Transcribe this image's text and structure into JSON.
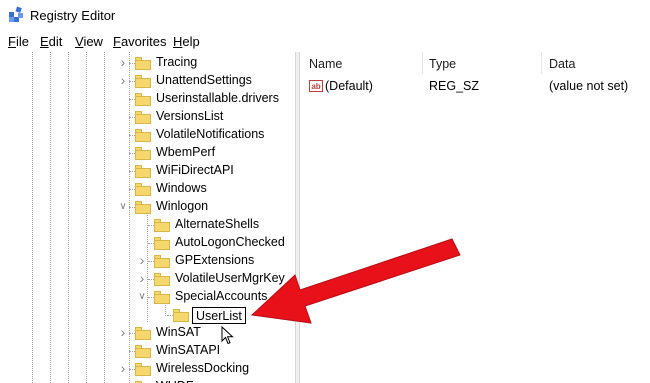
{
  "window": {
    "title": "Registry Editor"
  },
  "menu": [
    "File",
    "Edit",
    "View",
    "Favorites",
    "Help"
  ],
  "tree": {
    "items": [
      {
        "label": "Tracing",
        "chevron": "right",
        "level": 0
      },
      {
        "label": "UnattendSettings",
        "chevron": "right",
        "level": 0
      },
      {
        "label": "Userinstallable.drivers",
        "chevron": "none",
        "level": 0
      },
      {
        "label": "VersionsList",
        "chevron": "none",
        "level": 0
      },
      {
        "label": "VolatileNotifications",
        "chevron": "none",
        "level": 0
      },
      {
        "label": "WbemPerf",
        "chevron": "none",
        "level": 0
      },
      {
        "label": "WiFiDirectAPI",
        "chevron": "none",
        "level": 0
      },
      {
        "label": "Windows",
        "chevron": "none",
        "level": 0
      },
      {
        "label": "Winlogon",
        "chevron": "down",
        "level": 0
      },
      {
        "label": "AlternateShells",
        "chevron": "none",
        "level": 1
      },
      {
        "label": "AutoLogonChecked",
        "chevron": "none",
        "level": 1
      },
      {
        "label": "GPExtensions",
        "chevron": "right",
        "level": 1
      },
      {
        "label": "VolatileUserMgrKey",
        "chevron": "right",
        "level": 1
      },
      {
        "label": "SpecialAccounts",
        "chevron": "down",
        "level": 1
      },
      {
        "label": "UserList",
        "chevron": "none",
        "level": 2,
        "editing": true
      },
      {
        "label": "WinSAT",
        "chevron": "right",
        "level": 0
      },
      {
        "label": "WinSATAPI",
        "chevron": "none",
        "level": 0
      },
      {
        "label": "WirelessDocking",
        "chevron": "right",
        "level": 0
      },
      {
        "label": "WUDF",
        "chevron": "right",
        "level": 0
      }
    ]
  },
  "values": {
    "headers": {
      "name": "Name",
      "type": "Type",
      "data": "Data"
    },
    "rows": [
      {
        "icon": "string-value-icon",
        "icon_text": "ab",
        "name": "(Default)",
        "type": "REG_SZ",
        "data": "(value not set)"
      }
    ]
  },
  "annotation": {
    "arrow_color": "#e8111a",
    "target": "UserList"
  }
}
